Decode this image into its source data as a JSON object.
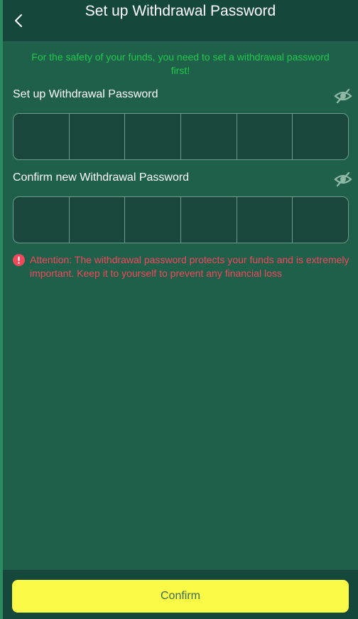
{
  "header": {
    "title": "Set up Withdrawal Password"
  },
  "notice": "For the safety of your funds, you need to set a withdrawal password first!",
  "fields": [
    {
      "label": "Set up Withdrawal Password",
      "cells": 6,
      "visibility_icon": "eye-off-icon"
    },
    {
      "label": "Confirm new Withdrawal Password",
      "cells": 6,
      "visibility_icon": "eye-off-icon"
    }
  ],
  "attention": {
    "icon": "exclamation-circle-icon",
    "text": "Attention: The withdrawal password protects your funds and is extremely important. Keep it to yourself to prevent any financial loss"
  },
  "footer": {
    "confirm_label": "Confirm"
  },
  "colors": {
    "background": "#1f604b",
    "header": "#15473a",
    "notice": "#21c84a",
    "warning": "#f0485a",
    "button": "#fbfa46"
  }
}
